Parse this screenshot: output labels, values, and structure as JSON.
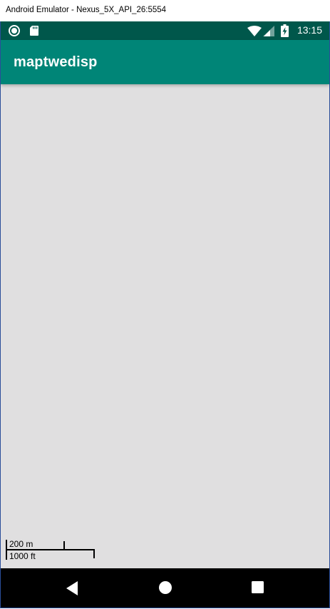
{
  "window": {
    "title": "Android Emulator - Nexus_5X_API_26:5554"
  },
  "status_bar": {
    "time": "13:15",
    "icons": [
      "notification-circle-icon",
      "sd-card-icon",
      "wifi-icon",
      "cell-signal-icon",
      "battery-charging-icon"
    ]
  },
  "app_bar": {
    "title": "maptwedisp"
  },
  "map": {
    "scale": {
      "metric_label": "200 m",
      "imperial_label": "1000 ft"
    }
  },
  "nav_bar": {
    "buttons": [
      "back-icon",
      "home-icon",
      "recents-icon"
    ]
  },
  "colors": {
    "status_bar": "#00574b",
    "app_bar": "#008577",
    "map_background": "#e0dfe0",
    "nav_bar": "#000000"
  }
}
